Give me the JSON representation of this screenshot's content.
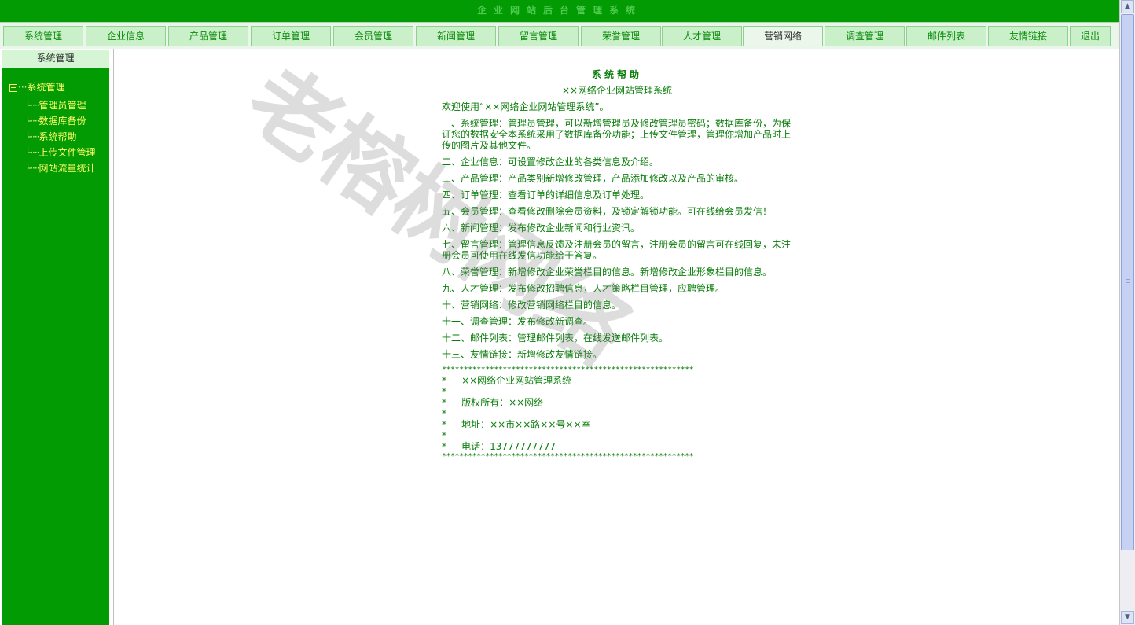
{
  "banner": {
    "title": "企业网站后台管理系统"
  },
  "nav": {
    "items": [
      {
        "label": "系统管理"
      },
      {
        "label": "企业信息"
      },
      {
        "label": "产品管理"
      },
      {
        "label": "订单管理"
      },
      {
        "label": "会员管理"
      },
      {
        "label": "新闻管理"
      },
      {
        "label": "留言管理"
      },
      {
        "label": "荣誉管理"
      },
      {
        "label": "人才管理"
      },
      {
        "label": "营销网络"
      },
      {
        "label": "调查管理"
      },
      {
        "label": "邮件列表"
      },
      {
        "label": "友情链接"
      },
      {
        "label": "退出"
      }
    ]
  },
  "sidebar": {
    "header": "系统管理",
    "root": "系统管理",
    "items": [
      {
        "label": "管理员管理"
      },
      {
        "label": "数据库备份"
      },
      {
        "label": "系统帮助"
      },
      {
        "label": "上传文件管理"
      },
      {
        "label": "网站流量统计"
      }
    ]
  },
  "help": {
    "title": "系统帮助",
    "subtitle": "××网络企业网站管理系统",
    "welcome": "欢迎使用“××网络企业网站管理系统”。",
    "paragraphs": [
      "一、系统管理：管理员管理，可以新增管理员及修改管理员密码；数据库备份，为保证您的数据安全本系统采用了数据库备份功能；上传文件管理，管理你增加产品时上传的图片及其他文件。",
      "二、企业信息：可设置修改企业的各类信息及介绍。",
      "三、产品管理：产品类别新增修改管理，产品添加修改以及产品的审核。",
      "四、订单管理：查看订单的详细信息及订单处理。",
      "五、会员管理：查看修改删除会员资料，及锁定解锁功能。可在线给会员发信！",
      "六、新闻管理：发布修改企业新闻和行业资讯。",
      "七、留言管理：管理信息反馈及注册会员的留言，注册会员的留言可在线回复，未注册会员可使用在线发信功能给于答复。",
      "八、荣誉管理：新增修改企业荣誉栏目的信息。新增修改企业形象栏目的信息。",
      "九、人才管理：发布修改招聘信息，人才策略栏目管理，应聘管理。",
      "十、营销网络：修改营销网络栏目的信息。",
      "十一、调查管理：发布修改新调查。",
      "十二、邮件列表：管理邮件列表，在线发送邮件列表。",
      "十三、友情链接：新增修改友情链接。"
    ],
    "stars": "**********************************************************",
    "box": [
      "*     ××网络企业网站管理系统",
      "*",
      "*     版权所有：××网络",
      "*",
      "*     地址：××市××路××号××室",
      "*",
      "*     电话：13777777777"
    ]
  },
  "watermark": {
    "text": "老榕树网络"
  },
  "colors": {
    "primary_green": "#039b03",
    "tree_text": "#ffff66",
    "help_text": "#0b7d0b"
  }
}
